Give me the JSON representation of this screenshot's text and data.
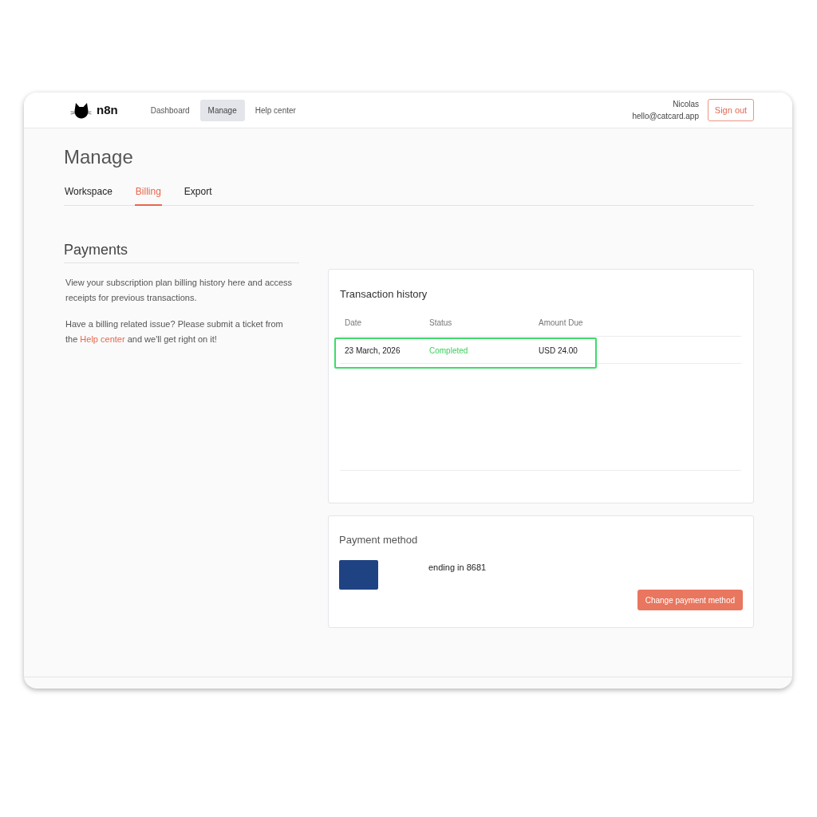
{
  "header": {
    "logo": {
      "text": "n8n"
    },
    "nav": [
      {
        "label": "Dashboard",
        "selected": false
      },
      {
        "label": "Manage",
        "selected": true
      },
      {
        "label": "Help center",
        "selected": false
      }
    ],
    "user": {
      "name": "Nicolas",
      "email": "hello@catcard.app"
    },
    "sign_out_button": "Sign out"
  },
  "page": {
    "title": "Manage",
    "tabs": [
      {
        "label": "Workspace",
        "selected": false
      },
      {
        "label": "Billing",
        "selected": true
      },
      {
        "label": "Export",
        "selected": false
      }
    ]
  },
  "payments": {
    "title": "Payments",
    "paragraphs": [
      {
        "text": "View your subscription plan billing history here and access receipts for previous transactions."
      },
      {
        "text": "Have a billing related issue? Please submit a ticket from the",
        "link": "Help center",
        "text_after": "and we'll get right on it!"
      }
    ]
  },
  "transactions": {
    "title": "Transaction history",
    "columns": [
      "Date",
      "Status",
      "Amount Due"
    ],
    "rows": [
      {
        "date": "23 March, 2026",
        "status": {
          "text": "Completed",
          "kind": "completed"
        },
        "amount": "USD 24.00",
        "highlighted": true
      }
    ]
  },
  "payment_method": {
    "title": "Payment method",
    "card_label": "ending in 8681",
    "button": "Change payment method"
  }
}
